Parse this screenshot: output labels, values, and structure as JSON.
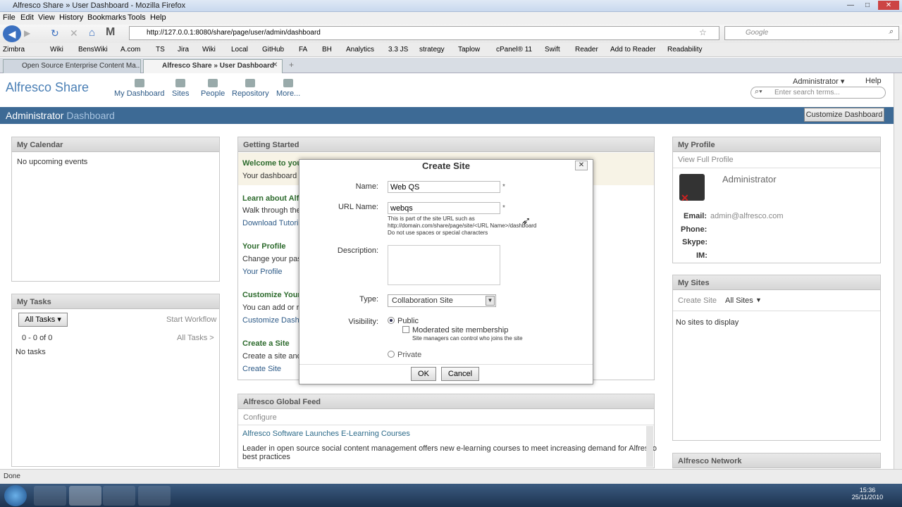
{
  "window": {
    "title": "Alfresco Share » User Dashboard - Mozilla Firefox"
  },
  "menu": [
    "File",
    "Edit",
    "View",
    "History",
    "Bookmarks",
    "Tools",
    "Help"
  ],
  "address": {
    "url": "http://127.0.0.1:8080/share/page/user/admin/dashboard",
    "search_placeholder": "Google"
  },
  "bookmarks": [
    "Zimbra",
    "Wiki",
    "BensWiki",
    "A.com",
    "TS",
    "Jira",
    "Wiki",
    "Local",
    "GitHub",
    "FA",
    "BH",
    "Analytics",
    "3.3 JS",
    "strategy",
    "Taplow",
    "cPanel® 11",
    "Swift",
    "Reader",
    "Add to Reader",
    "Readability"
  ],
  "tabs": [
    "Open Source Enterprise Content Ma...",
    "Alfresco Share » User Dashboard"
  ],
  "share": {
    "logo": "Alfresco Share",
    "nav": [
      "My Dashboard",
      "Sites",
      "People",
      "Repository",
      "More..."
    ],
    "user": "Administrator",
    "help": "Help",
    "search_placeholder": "Enter search terms...",
    "page_title_main": "Administrator",
    "page_title_light": " Dashboard",
    "customize": "Customize Dashboard"
  },
  "calendar": {
    "title": "My Calendar",
    "empty": "No upcoming events"
  },
  "tasks": {
    "title": "My Tasks",
    "filter": "All Tasks",
    "start": "Start Workflow",
    "count": "0 - 0 of 0",
    "all": "All Tasks >",
    "empty": "No tasks"
  },
  "getting_started": {
    "title": "Getting Started",
    "welcome": "Welcome to you",
    "welcome_sub": "Your dashboard g",
    "learn": "Learn about Alf",
    "learn_sub": "Walk through the",
    "learn_link": "Download Tutorial",
    "profile": "Your Profile",
    "profile_sub": "Change your pas",
    "profile_link": "Your Profile",
    "customize": "Customize Your",
    "customize_sub": "You can add or re",
    "customize_link": "Customize Dashb",
    "create": "Create a Site",
    "create_sub": "Create a site and",
    "create_link": "Create Site"
  },
  "feed": {
    "title": "Alfresco Global Feed",
    "configure": "Configure",
    "headline": "Alfresco Software Launches E-Learning Courses",
    "body1": "Leader in open source social content management offers new e-learning courses to meet increasing demand for Alfresco",
    "body2": "best practices"
  },
  "profile": {
    "title": "My Profile",
    "view": "View Full Profile",
    "name": "Administrator",
    "email_label": "Email:",
    "email": "admin@alfresco.com",
    "phone_label": "Phone:",
    "skype_label": "Skype:",
    "im_label": "IM:"
  },
  "sites": {
    "title": "My Sites",
    "create": "Create Site",
    "filter": "All Sites",
    "empty": "No sites to display"
  },
  "network": {
    "title": "Alfresco Network"
  },
  "dialog": {
    "title": "Create Site",
    "name_label": "Name:",
    "name_value": "Web QS",
    "url_label": "URL Name:",
    "url_value": "webqs",
    "hint1": "This is part of the site URL such as",
    "hint2": "http://domain.com/share/page/site/<URL Name>/dashboard",
    "hint3": "Do not use spaces or special characters",
    "desc_label": "Description:",
    "type_label": "Type:",
    "type_value": "Collaboration Site",
    "visibility_label": "Visibility:",
    "public": "Public",
    "moderated": "Moderated site membership",
    "moderated_hint": "Site managers can control who joins the site",
    "private": "Private",
    "ok": "OK",
    "cancel": "Cancel",
    "required": "*"
  },
  "status": "Done",
  "clock": {
    "time": "15:36",
    "date": "25/11/2010"
  }
}
